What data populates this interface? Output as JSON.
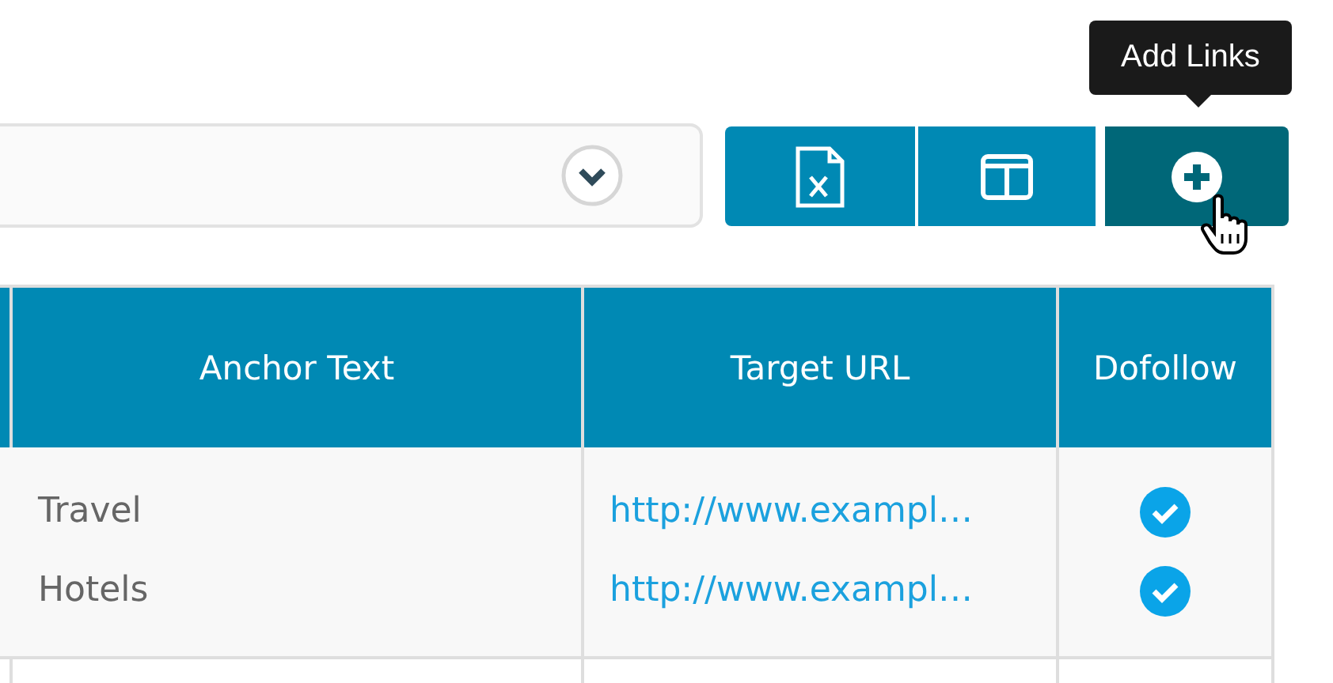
{
  "dropdown": {
    "expanded": false
  },
  "toolbar": {
    "buttons": [
      {
        "kind": "excel",
        "hovered": false
      },
      {
        "kind": "columns",
        "hovered": false
      },
      {
        "kind": "add",
        "hovered": true
      }
    ],
    "tooltip": "Add Links"
  },
  "table": {
    "columns": [
      "Anchor Text",
      "Target URL",
      "Dofollow"
    ],
    "rows": [
      {
        "links": [
          {
            "anchor": "Travel",
            "url": "http://www.exampl…",
            "dofollow": true
          },
          {
            "anchor": "Hotels",
            "url": "http://www.exampl…",
            "dofollow": true
          }
        ]
      }
    ]
  }
}
